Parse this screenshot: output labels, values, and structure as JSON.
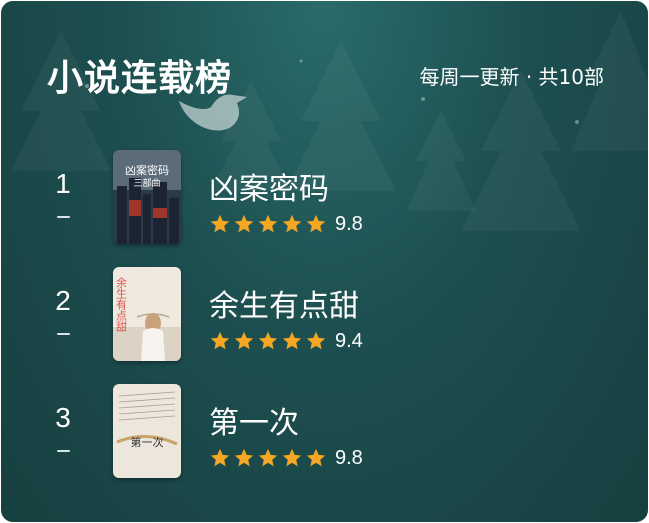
{
  "header": {
    "title": "小说连载榜",
    "subtitle": "每周一更新 · 共10部"
  },
  "items": [
    {
      "rank": "1",
      "name": "凶案密码",
      "rating": 5,
      "score": "9.8",
      "cover": {
        "title": "凶案密码",
        "subtitle": "三部曲"
      }
    },
    {
      "rank": "2",
      "name": "余生有点甜",
      "rating": 5,
      "score": "9.4",
      "cover": {
        "title": "余生有点甜"
      }
    },
    {
      "rank": "3",
      "name": "第一次",
      "rating": 5,
      "score": "9.8",
      "cover": {
        "title": "第一次"
      }
    }
  ],
  "colors": {
    "star": "#f5a623",
    "background": "#1d4f50",
    "text": "#ffffff"
  },
  "icons": {
    "star": "star-icon",
    "bird": "bird-icon",
    "tree": "tree-icon"
  }
}
